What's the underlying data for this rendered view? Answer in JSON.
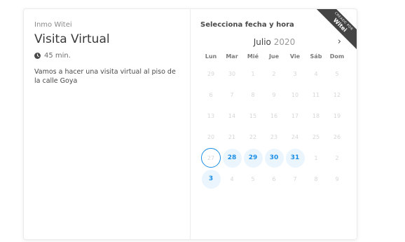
{
  "event": {
    "organizer": "Inmo Witei",
    "title": "Visita Virtual",
    "duration": "45 min.",
    "description": "Vamos a hacer una visita virtual al piso de la calle Goya"
  },
  "calendar": {
    "heading": "Selecciona fecha y hora",
    "month": "Julio",
    "year": "2020",
    "next_icon": "chevron-right-icon",
    "weekdays": [
      "Lun",
      "Mar",
      "Mié",
      "Jue",
      "Vie",
      "Sáb",
      "Dom"
    ],
    "days": [
      {
        "label": "29",
        "state": "other"
      },
      {
        "label": "30",
        "state": "other"
      },
      {
        "label": "1",
        "state": "disabled"
      },
      {
        "label": "2",
        "state": "disabled"
      },
      {
        "label": "3",
        "state": "disabled"
      },
      {
        "label": "4",
        "state": "disabled"
      },
      {
        "label": "5",
        "state": "disabled"
      },
      {
        "label": "6",
        "state": "disabled"
      },
      {
        "label": "7",
        "state": "disabled"
      },
      {
        "label": "8",
        "state": "disabled"
      },
      {
        "label": "9",
        "state": "disabled"
      },
      {
        "label": "10",
        "state": "disabled"
      },
      {
        "label": "11",
        "state": "disabled"
      },
      {
        "label": "12",
        "state": "disabled"
      },
      {
        "label": "13",
        "state": "disabled"
      },
      {
        "label": "14",
        "state": "disabled"
      },
      {
        "label": "15",
        "state": "disabled"
      },
      {
        "label": "16",
        "state": "disabled"
      },
      {
        "label": "17",
        "state": "disabled"
      },
      {
        "label": "18",
        "state": "disabled"
      },
      {
        "label": "19",
        "state": "disabled"
      },
      {
        "label": "20",
        "state": "disabled"
      },
      {
        "label": "21",
        "state": "disabled"
      },
      {
        "label": "22",
        "state": "disabled"
      },
      {
        "label": "23",
        "state": "disabled"
      },
      {
        "label": "24",
        "state": "disabled"
      },
      {
        "label": "25",
        "state": "disabled"
      },
      {
        "label": "26",
        "state": "disabled"
      },
      {
        "label": "27",
        "state": "today"
      },
      {
        "label": "28",
        "state": "available"
      },
      {
        "label": "29",
        "state": "available"
      },
      {
        "label": "30",
        "state": "available"
      },
      {
        "label": "31",
        "state": "available"
      },
      {
        "label": "1",
        "state": "other"
      },
      {
        "label": "2",
        "state": "other"
      },
      {
        "label": "3",
        "state": "available"
      },
      {
        "label": "4",
        "state": "other"
      },
      {
        "label": "5",
        "state": "other"
      },
      {
        "label": "6",
        "state": "other"
      },
      {
        "label": "7",
        "state": "other"
      },
      {
        "label": "8",
        "state": "other"
      },
      {
        "label": "9",
        "state": "other"
      }
    ]
  },
  "ribbon": {
    "top_text": "CREADO POR",
    "brand": "Witei"
  },
  "colors": {
    "accent": "#1a8ee6",
    "available_bg": "#eaf5fd",
    "ribbon_bg": "#444444"
  }
}
